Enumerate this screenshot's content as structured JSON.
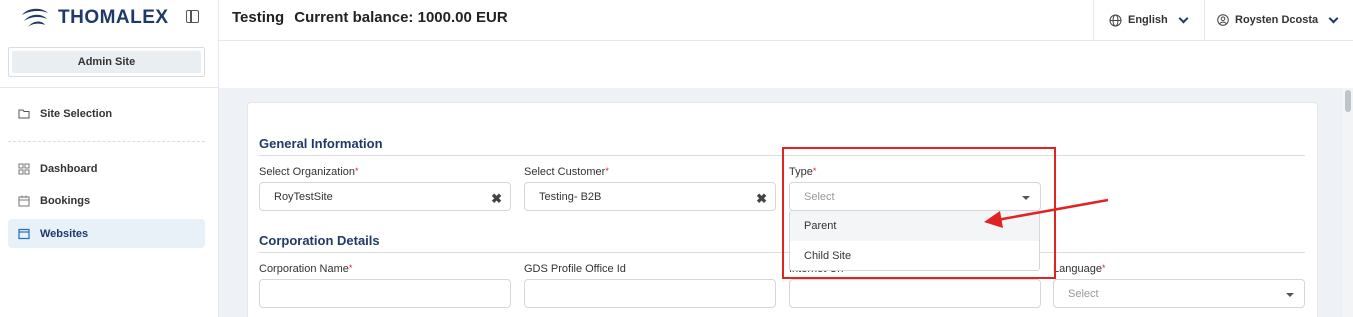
{
  "brand": {
    "name": "THOMALEX"
  },
  "sidebar": {
    "site_label": "Admin Site",
    "items": [
      {
        "label": "Site Selection",
        "icon": "folder-icon"
      },
      {
        "label": "Dashboard",
        "icon": "grid-icon"
      },
      {
        "label": "Bookings",
        "icon": "calendar-icon"
      },
      {
        "label": "Websites",
        "icon": "browser-icon",
        "active": true
      }
    ]
  },
  "header": {
    "title": "Testing",
    "balance": "Current balance: 1000.00 EUR",
    "language": "English",
    "user": "Roysten Dcosta"
  },
  "form": {
    "general_title": "General Information",
    "org_label": "Select Organization",
    "org_value": "RoyTestSite",
    "customer_label": "Select Customer",
    "customer_value": "Testing- B2B",
    "type_label": "Type",
    "type_placeholder": "Select",
    "type_options": [
      "Parent",
      "Child Site"
    ],
    "corp_title": "Corporation Details",
    "corp_name_label": "Corporation Name",
    "gds_label": "GDS Profile Office Id",
    "internet_label": "Internet Url",
    "language_label": "Language",
    "language_placeholder": "Select"
  },
  "colors": {
    "brand": "#1f3a68",
    "highlight": "#e02424",
    "active_bg": "#e8f0f8"
  }
}
